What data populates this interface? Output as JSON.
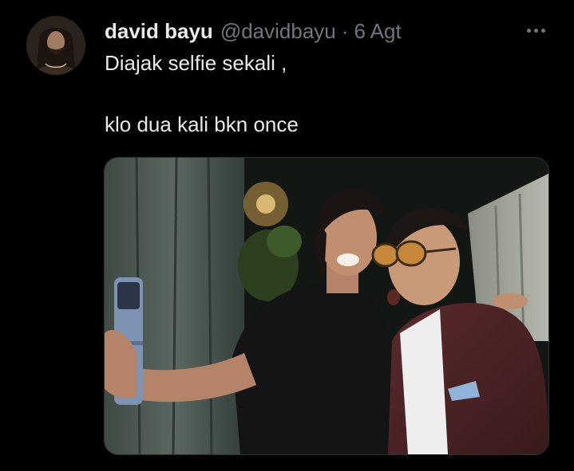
{
  "tweet": {
    "author_name": "david bayu",
    "author_handle": "@davidbayu",
    "separator": "·",
    "date": "6 Agt",
    "text_line1": "Diajak selfie sekali ,",
    "text_line2": "klo dua kali bkn once"
  },
  "icons": {
    "more": "more-horizontal-icon"
  },
  "colors": {
    "background": "#000000",
    "primary_text": "#e7e9ea",
    "secondary_text": "#71767b",
    "media_border": "#2f3336"
  }
}
